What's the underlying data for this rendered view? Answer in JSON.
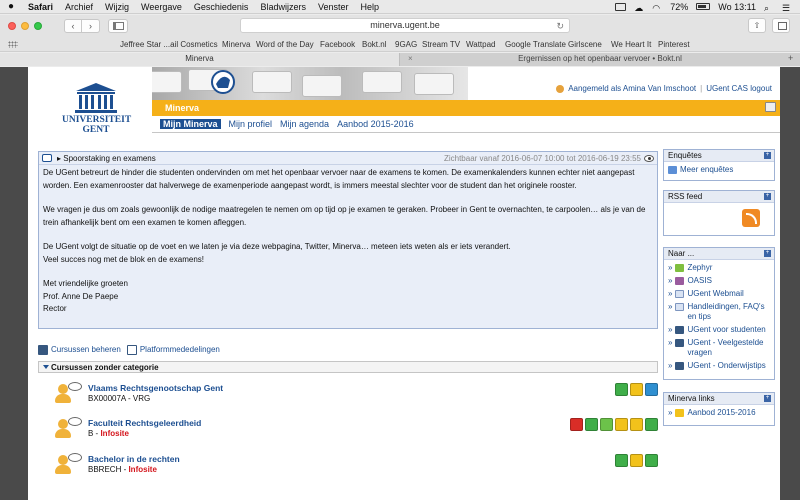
{
  "menubar": {
    "items": [
      "Safari",
      "Archief",
      "Wijzig",
      "Weergave",
      "Geschiedenis",
      "Bladwijzers",
      "Venster",
      "Help"
    ],
    "battery": "72%",
    "clock": "Wo 13:11"
  },
  "toolbar": {
    "url": "minerva.ugent.be"
  },
  "bookmarks": [
    "Jeffree Star ...ail Cosmetics",
    "Minerva",
    "Word of the Day",
    "Facebook",
    "Bokt.nl",
    "9GAG",
    "Stream TV",
    "Wattpad",
    "Google Translate",
    "Girlscene",
    "We Heart It",
    "Pinterest"
  ],
  "tabs": {
    "active": "Minerva",
    "inactive": "Ergernissen op het openbaar vervoer • Bokt.nl"
  },
  "header": {
    "logo_line1": "UNIVERSITEIT",
    "logo_line2": "GENT",
    "user_text": "Aangemeld als Amina Van Imschoot",
    "logout": "UGent CAS logout",
    "site_title": "Minerva",
    "nav": [
      "Mijn Minerva",
      "Mijn profiel",
      "Mijn agenda",
      "Aanbod 2015-2016"
    ]
  },
  "announcement": {
    "subject": "Spoorstaking en examens",
    "visibility": "Zichtbaar vanaf 2016-06-07 10:00 tot 2016-06-19 23:55",
    "p1": "De UGent betreurt de hinder die studenten ondervinden om met het openbaar vervoer naar de examens te komen. De examenkalenders kunnen echter niet aangepast worden. Een examenrooster dat halverwege de examenperiode aangepast wordt, is immers meestal slechter voor de student dan het originele rooster.",
    "p2": "We vragen je dus om zoals gewoonlijk de nodige maatregelen te nemen om op tijd op je examen te geraken. Probeer in Gent te overnachten, te carpoolen… als je van de trein afhankelijk bent om een examen te komen afleggen.",
    "p3a": "De UGent volgt de situatie op de voet en we laten je via deze webpagina, Twitter, Minerva… meteen iets weten als er iets verandert.",
    "p3b": "Veel succes nog met de blok en de examens!",
    "sign1": "Met vriendelijke groeten",
    "sign2": "Prof. Anne De Paepe",
    "sign3": "Rector"
  },
  "tools": {
    "manage": "Cursussen beheren",
    "platform": "Platformmededelingen"
  },
  "category": "Cursussen zonder categorie",
  "courses": [
    {
      "name": "Vlaams Rechtsgenootschap Gent",
      "code": "BX00007A - VRG",
      "infosite": ""
    },
    {
      "name": "Faculteit Rechtsgeleerdheid",
      "code": "B - ",
      "infosite": "Infosite"
    },
    {
      "name": "Bachelor in de rechten",
      "code": "BBRECH - ",
      "infosite": "Infosite"
    }
  ],
  "sidebar": {
    "enquetes_title": "Enquêtes",
    "enquetes_link": "Meer enquêtes",
    "rss_title": "RSS feed",
    "naar_title": "Naar ...",
    "naar_links": [
      "Zephyr",
      "OASIS",
      "UGent Webmail",
      "Handleidingen, FAQ's en tips",
      "UGent voor studenten",
      "UGent - Veelgestelde vragen",
      "UGent - Onderwijstips"
    ],
    "minerva_title": "Minerva links",
    "minerva_link": "Aanbod 2015-2016"
  }
}
